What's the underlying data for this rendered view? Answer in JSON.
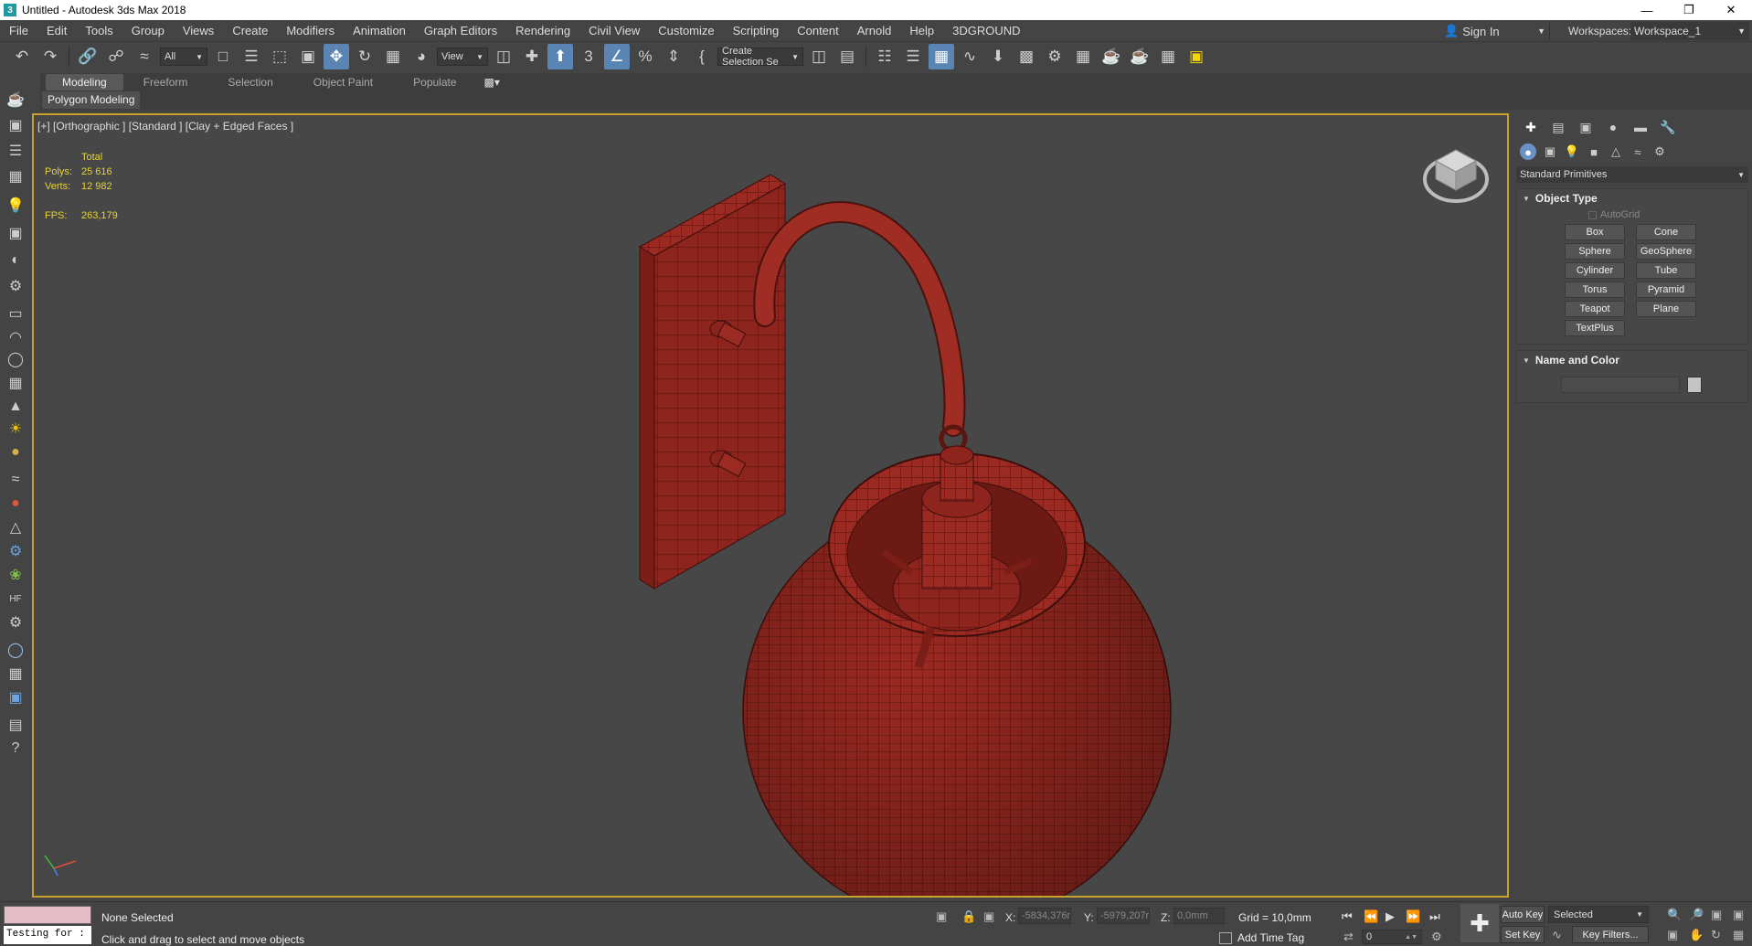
{
  "window": {
    "title": "Untitled - Autodesk 3ds Max 2018",
    "app_icon_glyph": "3",
    "minimize_glyph": "—",
    "restore_glyph": "❐",
    "close_glyph": "✕"
  },
  "menu": {
    "items": [
      "File",
      "Edit",
      "Tools",
      "Group",
      "Views",
      "Create",
      "Modifiers",
      "Animation",
      "Graph Editors",
      "Rendering",
      "Civil View",
      "Customize",
      "Scripting",
      "Content",
      "Arnold",
      "Help",
      "3DGROUND"
    ],
    "sign_in": "Sign In",
    "workspaces_label": "Workspaces:",
    "workspace_value": "Workspace_1"
  },
  "toolbar": {
    "selection_filter": "All",
    "reference_coord": "View",
    "named_selection": "Create Selection Se"
  },
  "ribbon": {
    "tabs": [
      "Modeling",
      "Freeform",
      "Selection",
      "Object Paint",
      "Populate"
    ],
    "active_tab": "Modeling",
    "subpanel": "Polygon Modeling"
  },
  "viewport": {
    "label": "[+] [Orthographic ] [Standard ] [Clay + Edged Faces ]",
    "stats": {
      "header": "Total",
      "polys_label": "Polys:",
      "polys_value": "25 616",
      "verts_label": "Verts:",
      "verts_value": "12 982",
      "fps_label": "FPS:",
      "fps_value": "263,179"
    },
    "model_color": "#9b2a22"
  },
  "command_panel": {
    "category": "Standard Primitives",
    "object_type_title": "Object Type",
    "autogrid_label": "AutoGrid",
    "primitives": [
      "Box",
      "Cone",
      "Sphere",
      "GeoSphere",
      "Cylinder",
      "Tube",
      "Torus",
      "Pyramid",
      "Teapot",
      "Plane",
      "TextPlus"
    ],
    "name_color_title": "Name and Color"
  },
  "status": {
    "maxscript_text": "Testing for :",
    "selection": "None Selected",
    "prompt": "Click and drag to select and move objects",
    "x_label": "X:",
    "x_value": "-5834,376r",
    "y_label": "Y:",
    "y_value": "-5979,207r",
    "z_label": "Z:",
    "z_value": "0,0mm",
    "grid": "Grid = 10,0mm",
    "add_time_tag": "Add Time Tag",
    "frame": "0",
    "auto_key": "Auto Key",
    "set_key": "Set Key",
    "key_mode": "Selected",
    "key_filters": "Key Filters..."
  }
}
